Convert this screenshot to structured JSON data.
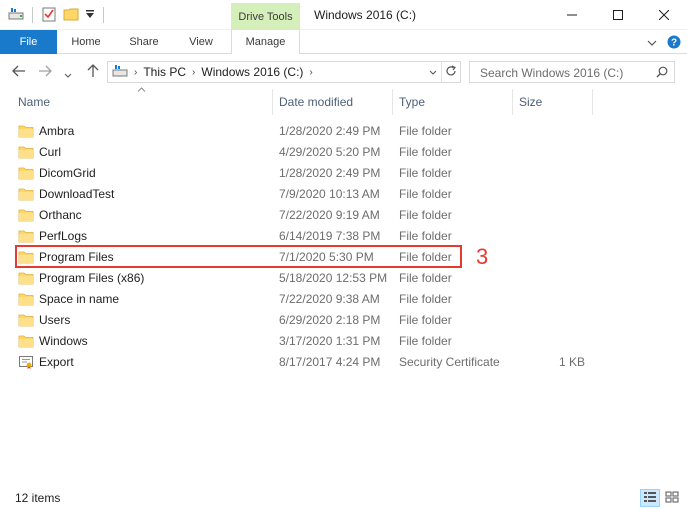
{
  "window": {
    "title": "Windows 2016 (C:)",
    "contextual_tab_group": "Drive Tools",
    "controls": [
      "minimize",
      "maximize",
      "close"
    ]
  },
  "quick_access_toolbar": {
    "icons": [
      "properties-icon",
      "new-folder-icon",
      "customize-dropdown-icon"
    ]
  },
  "ribbon": {
    "tabs": [
      {
        "label": "File",
        "active": true
      },
      {
        "label": "Home"
      },
      {
        "label": "Share"
      },
      {
        "label": "View"
      },
      {
        "label": "Manage"
      }
    ]
  },
  "address": {
    "crumbs": [
      "This PC",
      "Windows 2016 (C:)"
    ]
  },
  "search": {
    "placeholder": "Search Windows 2016 (C:)"
  },
  "columns": {
    "name": "Name",
    "date": "Date modified",
    "type": "Type",
    "size": "Size"
  },
  "files": [
    {
      "name": "Ambra",
      "date": "1/28/2020 2:49 PM",
      "type": "File folder",
      "size": "",
      "icon": "folder-icon"
    },
    {
      "name": "Curl",
      "date": "4/29/2020 5:20 PM",
      "type": "File folder",
      "size": "",
      "icon": "folder-icon"
    },
    {
      "name": "DicomGrid",
      "date": "1/28/2020 2:49 PM",
      "type": "File folder",
      "size": "",
      "icon": "folder-icon"
    },
    {
      "name": "DownloadTest",
      "date": "7/9/2020 10:13 AM",
      "type": "File folder",
      "size": "",
      "icon": "folder-icon"
    },
    {
      "name": "Orthanc",
      "date": "7/22/2020 9:19 AM",
      "type": "File folder",
      "size": "",
      "icon": "folder-icon"
    },
    {
      "name": "PerfLogs",
      "date": "6/14/2019 7:38 PM",
      "type": "File folder",
      "size": "",
      "icon": "folder-icon"
    },
    {
      "name": "Program Files",
      "date": "7/1/2020 5:30 PM",
      "type": "File folder",
      "size": "",
      "icon": "folder-icon"
    },
    {
      "name": "Program Files (x86)",
      "date": "5/18/2020 12:53 PM",
      "type": "File folder",
      "size": "",
      "icon": "folder-icon"
    },
    {
      "name": "Space in name",
      "date": "7/22/2020 9:38 AM",
      "type": "File folder",
      "size": "",
      "icon": "folder-icon"
    },
    {
      "name": "Users",
      "date": "6/29/2020 2:18 PM",
      "type": "File folder",
      "size": "",
      "icon": "folder-icon"
    },
    {
      "name": "Windows",
      "date": "3/17/2020 1:31 PM",
      "type": "File folder",
      "size": "",
      "icon": "folder-icon"
    },
    {
      "name": "Export",
      "date": "8/17/2017 4:24 PM",
      "type": "Security Certificate",
      "size": "1 KB",
      "icon": "certificate-icon"
    }
  ],
  "annotation": {
    "step_number": "3",
    "color": "#e53a2f"
  },
  "status": {
    "item_count": "12 items"
  },
  "colors": {
    "file_tab": "#1979ca",
    "drive_tools": "#d5efbb",
    "folder": "#ffd766",
    "header_text": "#4c607a"
  }
}
